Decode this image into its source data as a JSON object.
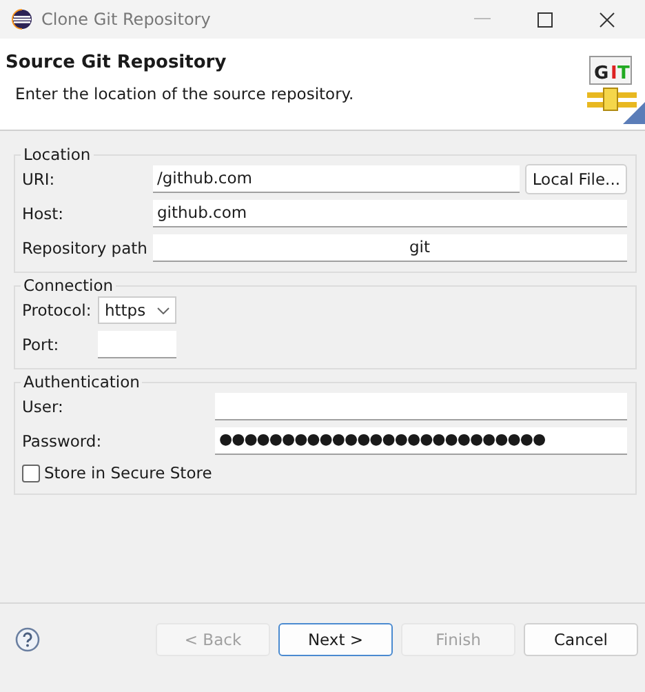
{
  "window": {
    "title": "Clone Git Repository"
  },
  "header": {
    "title": "Source Git Repository",
    "description": "Enter the location of the source repository.",
    "logo": [
      {
        "text": "G",
        "color": "#222222"
      },
      {
        "text": "I",
        "color": "#dd2222"
      },
      {
        "text": "T",
        "color": "#22aa22"
      }
    ]
  },
  "location": {
    "legend": "Location",
    "uri": {
      "label": "URI:",
      "value": "/github.com"
    },
    "local_file_button": "Local File...",
    "host": {
      "label": "Host:",
      "value": "github.com"
    },
    "repository_path": {
      "label": "Repository path",
      "value": "git"
    }
  },
  "connection": {
    "legend": "Connection",
    "protocol": {
      "label": "Protocol:",
      "value": "https"
    },
    "port": {
      "label": "Port:"
    }
  },
  "authentication": {
    "legend": "Authentication",
    "user": {
      "label": "User:"
    },
    "password": {
      "label": "Password:",
      "value": "●●●●●●●●●●●●●●●●●●●●●●●●●●"
    },
    "store": {
      "label": "Store in Secure Store",
      "checked": false
    }
  },
  "buttons": [
    {
      "label": "< Back",
      "disabled": true,
      "default": false
    },
    {
      "label": "Next >",
      "disabled": false,
      "default": true
    },
    {
      "label": "Finish",
      "disabled": true,
      "default": false
    },
    {
      "label": "Cancel",
      "disabled": false,
      "default": false
    }
  ]
}
